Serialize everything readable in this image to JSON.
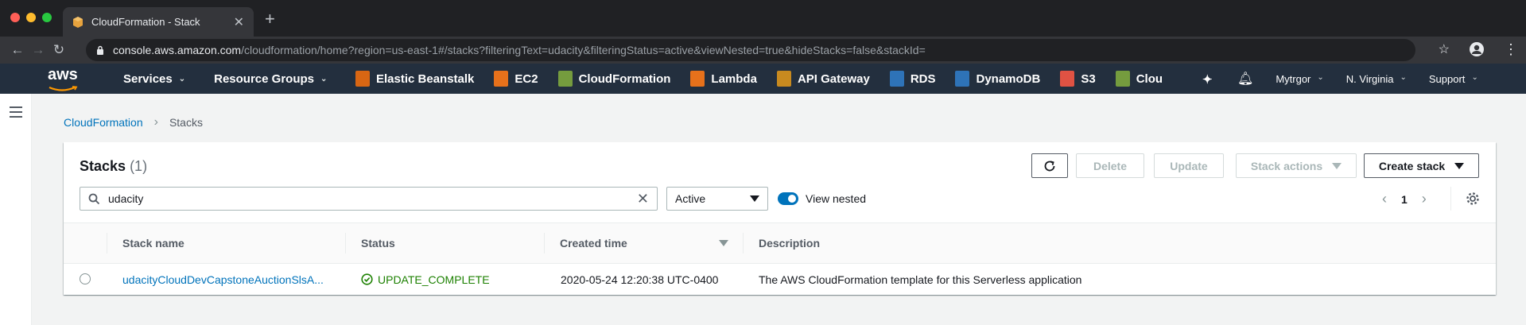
{
  "browser": {
    "tab_title": "CloudFormation - Stack",
    "url_host": "console.aws.amazon.com",
    "url_path": "/cloudformation/home?region=us-east-1#/stacks?filteringText=udacity&filteringStatus=active&viewNested=true&hideStacks=false&stackId="
  },
  "aws_nav": {
    "logo_text": "aws",
    "services": "Services",
    "resource_groups": "Resource Groups",
    "shortcuts": [
      {
        "label": "Elastic Beanstalk",
        "icon": "elastic-beanstalk-icon",
        "color": "#d86613"
      },
      {
        "label": "EC2",
        "icon": "ec2-icon",
        "color": "#e7711b"
      },
      {
        "label": "CloudFormation",
        "icon": "cloudformation-icon",
        "color": "#759c3e"
      },
      {
        "label": "Lambda",
        "icon": "lambda-icon",
        "color": "#e7711b"
      },
      {
        "label": "API Gateway",
        "icon": "api-gateway-icon",
        "color": "#c88a1f"
      },
      {
        "label": "RDS",
        "icon": "rds-icon",
        "color": "#2e73b8"
      },
      {
        "label": "DynamoDB",
        "icon": "dynamodb-icon",
        "color": "#2e73b8"
      },
      {
        "label": "S3",
        "icon": "s3-icon",
        "color": "#e05243"
      },
      {
        "label": "Clou",
        "icon": "cloud9-icon",
        "color": "#759c3e"
      }
    ],
    "account": "Mytrgor",
    "region": "N. Virginia",
    "support": "Support"
  },
  "breadcrumb": {
    "parent": "CloudFormation",
    "current": "Stacks"
  },
  "panel": {
    "title": "Stacks",
    "count": "(1)",
    "buttons": {
      "delete": "Delete",
      "update": "Update",
      "stack_actions": "Stack actions",
      "create_stack": "Create stack"
    },
    "search_value": "udacity",
    "filter_select": "Active",
    "view_nested_label": "View nested",
    "view_nested_on": true,
    "page": "1"
  },
  "table": {
    "columns": [
      "Stack name",
      "Status",
      "Created time",
      "Description"
    ],
    "rows": [
      {
        "stack_name": "udacityCloudDevCapstoneAuctionSlsA...",
        "status": "UPDATE_COMPLETE",
        "created": "2020-05-24 12:20:38 UTC-0400",
        "description": "The AWS CloudFormation template for this Serverless application"
      }
    ]
  },
  "colors": {
    "aws_nav_bg": "#232f3e",
    "link": "#0073bb",
    "success": "#1d8102",
    "aws_orange": "#ff9900"
  }
}
